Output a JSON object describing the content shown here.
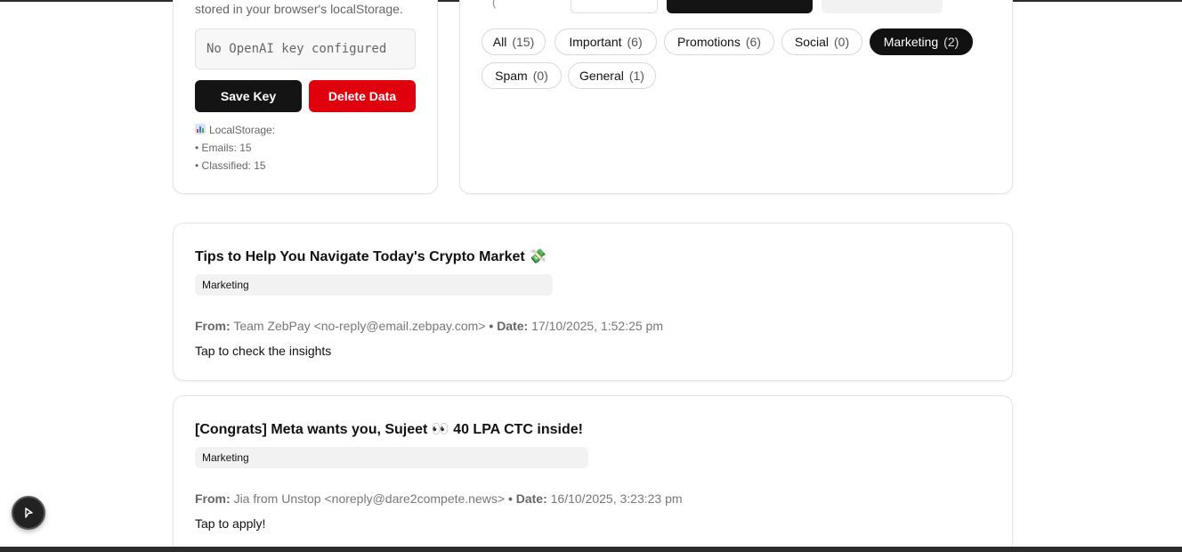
{
  "settings": {
    "note": "stored in your browser's localStorage.",
    "key_placeholder": "No OpenAI key configured",
    "save_label": "Save Key",
    "delete_label": "Delete Data",
    "storage_title": "LocalStorage:",
    "emails_line": "• Emails: 15",
    "classified_line": "• Classified: 15"
  },
  "filters": {
    "chips": [
      {
        "label": "All",
        "count": "(15)",
        "active": false
      },
      {
        "label": "Important",
        "count": "(6)",
        "active": false
      },
      {
        "label": "Promotions",
        "count": "(6)",
        "active": false
      },
      {
        "label": "Social",
        "count": "(0)",
        "active": false
      },
      {
        "label": "Marketing",
        "count": "(2)",
        "active": true
      },
      {
        "label": "Spam",
        "count": "(0)",
        "active": false
      },
      {
        "label": "General",
        "count": "(1)",
        "active": false
      }
    ]
  },
  "emails": [
    {
      "title": "Tips to Help You Navigate Today's Crypto Market 💸",
      "category": "Marketing",
      "from_label": "From:",
      "from": "Team ZebPay <no-reply@email.zebpay.com>",
      "date_label": "• Date:",
      "date": "17/10/2025, 1:52:25 pm",
      "snippet": "Tap to check the insights"
    },
    {
      "title": "[Congrats] Meta wants you, Sujeet 👀 40 LPA CTC inside!",
      "category": "Marketing",
      "from_label": "From:",
      "from": "Jia from Unstop <noreply@dare2compete.news>",
      "date_label": "• Date:",
      "date": "16/10/2025, 3:23:23 pm",
      "snippet": "Tap to apply!"
    }
  ],
  "colors": {
    "primary": "#141414",
    "danger": "#e0000d",
    "tag_bg": "#f2f2f2"
  },
  "icons": {
    "storage": "bar-chart-icon",
    "fab": "arrow-cursor-icon"
  }
}
